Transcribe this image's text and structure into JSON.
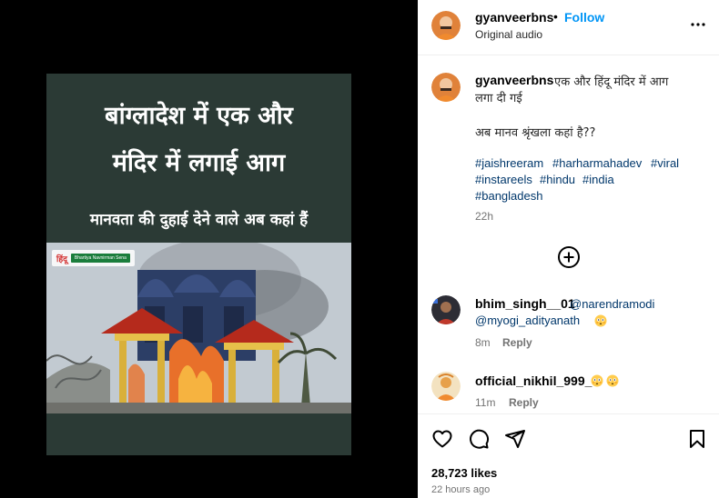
{
  "post": {
    "username": "gyanveerbns",
    "follow_label": "Follow",
    "separator": "•",
    "audio_label": "Original audio",
    "more_icon": "more-horizontal-icon"
  },
  "reel": {
    "headline_line1": "बांग्लादेश में एक और",
    "headline_line2": "मंदिर में लगाई आग",
    "subheadline": "मानवता की दुहाई देने वाले अब कहां हैं",
    "brand_mark": "हिंदू",
    "brand_name": "Bhartiya Navnirman Sena",
    "colors": {
      "background": "#2b3a35",
      "fire": "#e8702a",
      "roof": "#b52a1c"
    }
  },
  "caption": {
    "username": "gyanveerbns",
    "text_line1": "एक और हिंदू मंदिर में आग",
    "text_line2": "लगा दी गई",
    "text_line3": "अब मानव श्रृंखला कहां है??",
    "hashtags": [
      "#jaishreeram",
      "#harharmahadev",
      "#viral",
      "#instareels",
      "#hindu",
      "#india",
      "#bangladesh"
    ],
    "time": "22h"
  },
  "load_more_icon": "plus-circle-icon",
  "comments": [
    {
      "username": "bhim_singh__01",
      "mention1": "@narendramodi",
      "mention2": "@myogi_adityanath",
      "emoji": "flushed-face",
      "time": "8m",
      "reply_label": "Reply"
    },
    {
      "username": "official_nikhil_999_",
      "emoji": "flushed-face",
      "time": "11m",
      "reply_label": "Reply"
    }
  ],
  "actions": {
    "like_icon": "heart-icon",
    "comment_icon": "comment-icon",
    "share_icon": "share-icon",
    "save_icon": "bookmark-icon"
  },
  "likes": "28,723 likes",
  "posted_ago": "22 hours ago",
  "colors": {
    "link": "#0095f6",
    "hashtag": "#00376b",
    "muted": "#737373"
  }
}
